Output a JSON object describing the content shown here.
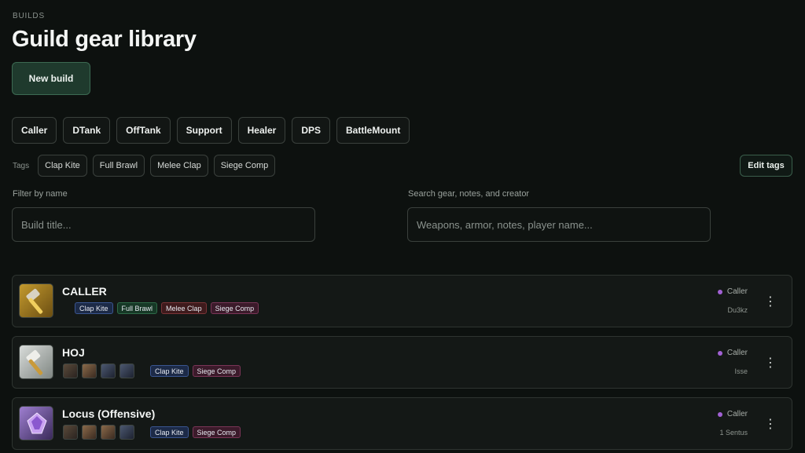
{
  "page": {
    "eyebrow": "BUILDS",
    "title": "Guild gear library",
    "new_build_label": "New build"
  },
  "roles": [
    "Caller",
    "DTank",
    "OffTank",
    "Support",
    "Healer",
    "DPS",
    "BattleMount"
  ],
  "tags": {
    "label": "Tags",
    "items": [
      "Clap Kite",
      "Full Brawl",
      "Melee Clap",
      "Siege Comp"
    ],
    "edit_label": "Edit tags"
  },
  "filters": {
    "name_label": "Filter by name",
    "name_placeholder": "Build title...",
    "search_label": "Search gear, notes, and creator",
    "search_placeholder": "Weapons, armor, notes, player name..."
  },
  "builds": [
    {
      "title": "CALLER",
      "icon": "golden-hammer-icon",
      "tags": [
        "Clap Kite",
        "Full Brawl",
        "Melee Clap",
        "Siege Comp"
      ],
      "role": "Caller",
      "creator": "Du3kz"
    },
    {
      "title": "HOJ",
      "icon": "silver-hammer-icon",
      "tags": [
        "Clap Kite",
        "Siege Comp"
      ],
      "role": "Caller",
      "creator": "Isse"
    },
    {
      "title": "Locus (Offensive)",
      "icon": "purple-gem-icon",
      "tags": [
        "Clap Kite",
        "Siege Comp"
      ],
      "role": "Caller",
      "creator": "1 Sentus"
    }
  ],
  "colors": {
    "background": "#0d110f",
    "accent": "#1f3a2d",
    "role_dot": "#a261d4"
  }
}
